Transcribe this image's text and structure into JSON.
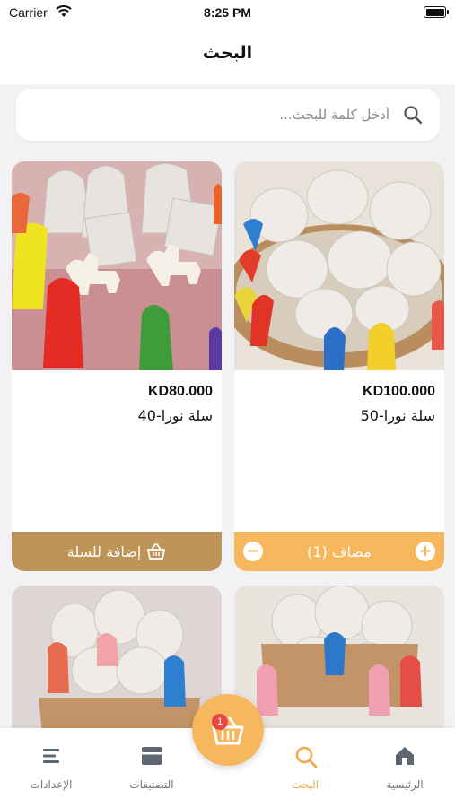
{
  "status_bar": {
    "carrier": "Carrier",
    "time": "8:25 PM"
  },
  "header": {
    "title": "البحث"
  },
  "search": {
    "placeholder": "أدخل كلمة للبحث..."
  },
  "products": [
    {
      "price": "KD100.000",
      "name": "سلة نورا-50",
      "in_cart": true,
      "cart_label": "مضاف (1)",
      "plus": "+",
      "minus": "−"
    },
    {
      "price": "KD80.000",
      "name": "سلة نورا-40",
      "in_cart": false,
      "cart_label": "إضافة للسلة"
    }
  ],
  "cart": {
    "count": "1"
  },
  "tabs": [
    {
      "label": "الرئيسية",
      "icon": "home-icon"
    },
    {
      "label": "البحث",
      "icon": "search-icon",
      "active": true
    },
    {
      "label": "التصنيفات",
      "icon": "categories-icon"
    },
    {
      "label": "الإعدادات",
      "icon": "menu-icon"
    }
  ],
  "colors": {
    "accent": "#f6b75d",
    "brand_brown": "#bf9458",
    "badge": "#e9463f"
  }
}
